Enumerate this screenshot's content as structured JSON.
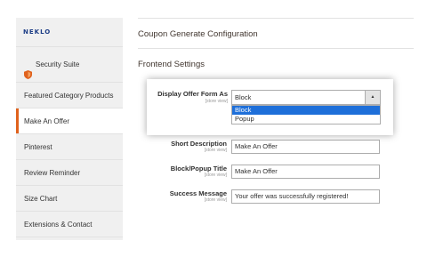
{
  "sidebar": {
    "logo": "NEKLO",
    "items": [
      {
        "label": "Security Suite",
        "icon": "shield-icon"
      },
      {
        "label": "Featured Category Products"
      },
      {
        "label": "Make An Offer",
        "active": true
      },
      {
        "label": "Pinterest"
      },
      {
        "label": "Review Reminder"
      },
      {
        "label": "Size Chart"
      },
      {
        "label": "Extensions & Contact"
      }
    ],
    "accent_color": "#e0621d"
  },
  "main": {
    "section_title": "Coupon Generate Configuration",
    "subsection_title": "Frontend Settings"
  },
  "fields": {
    "display_offer_form_as": {
      "label": "Display Offer Form As",
      "scope": "[store view]",
      "value": "Block",
      "options": [
        "Block",
        "Popup"
      ],
      "highlighted": "Block"
    },
    "short_description": {
      "label": "Short Description",
      "scope": "[store view]",
      "value": "Make An Offer"
    },
    "block_popup_title": {
      "label": "Block/Popup Title",
      "scope": "[store view]",
      "value": "Make An Offer"
    },
    "success_message": {
      "label": "Success Message",
      "scope": "[store view]",
      "value": "Your offer was successfully registered!"
    }
  },
  "colors": {
    "highlight_option": "#1e6fd9",
    "logo": "#1c3d86"
  }
}
